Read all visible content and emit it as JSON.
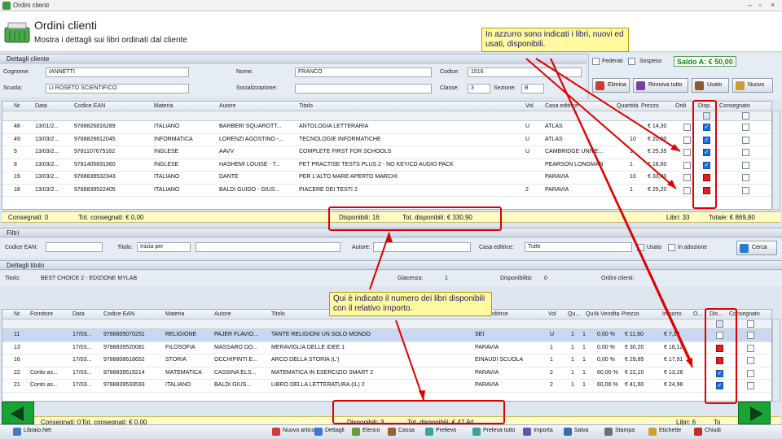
{
  "window": {
    "title": "Ordini clienti"
  },
  "header": {
    "title": "Ordini clienti",
    "subtitle": "Mostra i dettagli sui libri ordinati dal cliente"
  },
  "customer": {
    "section": "Dettagli cliente",
    "cognome_label": "Cognome:",
    "cognome": "IANNETTI",
    "nome_label": "Nome:",
    "nome": "FRANCO",
    "codice_label": "Codice:",
    "codice": "1516",
    "scuola_label": "Scuola:",
    "scuola": "LI ROSETO SCIENTIFICO",
    "socializzazione_label": "Socializzazione:",
    "classe_label": "Classe:",
    "classe": "3",
    "sezione_label": "Sezione:",
    "sezione": "B",
    "federati_label": "Federati",
    "sospeso_label": "Sospeso",
    "saldo": "Saldo A: € 50,00",
    "buttons": {
      "elimina": "Elimina",
      "rinnova": "Rinnova tutto",
      "usato": "Usato",
      "nuovo": "Nuovo"
    }
  },
  "orders": {
    "columns": [
      "Nr.",
      "Data",
      "Codice EAN",
      "Materia",
      "Autore",
      "Titolo",
      "Vol",
      "Casa editrice",
      "Quantità",
      "Prezzo",
      "Ordi",
      "Disp.",
      "Consegnato"
    ],
    "rows": [
      {
        "nr": "48",
        "data": "13/01/2...",
        "ean": "9788826816289",
        "materia": "ITALIANO",
        "autore": "BARBERI SQUAROTT...",
        "titolo": "ANTOLOGIA LETTERARIA",
        "vol": "U",
        "casa": "ATLAS",
        "qta": "",
        "prezzo": "€ 14,30",
        "disp": "blue"
      },
      {
        "nr": "49",
        "data": "13/03/2...",
        "ean": "9788826812045",
        "materia": "INFORMATICA",
        "autore": "LORENZI AGOSTINO -...",
        "titolo": "TECNOLOGIE INFORMATICHE",
        "vol": "U",
        "casa": "ATLAS",
        "qta": "10",
        "prezzo": "€ 20,00",
        "disp": "blue"
      },
      {
        "nr": "5",
        "data": "13/03/2...",
        "ean": "9781107675162",
        "materia": "INGLESE",
        "autore": "AAVV",
        "titolo": "COMPLETE FIRST FOR SCHOOLS",
        "vol": "U",
        "casa": "CAMBRIDGE UNIVE...",
        "qta": "1",
        "prezzo": "€ 25,35",
        "disp": "blue"
      },
      {
        "nr": "8",
        "data": "13/03/2...",
        "ean": "9781405831360",
        "materia": "INGLESE",
        "autore": "HASHEMI LOUISE - T...",
        "titolo": "PET PRACTISE TESTS PLUS 2 - NO KEY/CD AUDIO PACK",
        "vol": "",
        "casa": "PEARSON LONGMAN",
        "qta": "1",
        "prezzo": "€ 18,60",
        "disp": "blue"
      },
      {
        "nr": "19",
        "data": "13/03/2...",
        "ean": "9788839532343",
        "materia": "ITALIANO",
        "autore": "DANTE",
        "titolo": "PER L'ALTO MARE APERTO MARCHI",
        "vol": "",
        "casa": "PARAVIA",
        "qta": "10",
        "prezzo": "€ 33,40",
        "disp": "red"
      },
      {
        "nr": "18",
        "data": "13/03/2...",
        "ean": "9788839522405",
        "materia": "ITALIANO",
        "autore": "BALDI GUIDO - GIUS...",
        "titolo": "PIACERE DEI TESTI 2",
        "vol": "2",
        "casa": "PARAVIA",
        "qta": "1",
        "prezzo": "€ 25,20",
        "disp": "red"
      }
    ],
    "totals": {
      "consegnati": "Consegnati: 0",
      "tot_consegnati": "Tot. consegnati: € 0,00",
      "disponibili": "Disponibili: 16",
      "tot_disponibili": "Tot. disponibili: € 330,90",
      "libri": "Libri: 33",
      "totale": "Totale: € 869,80"
    }
  },
  "filters": {
    "section": "Filtri",
    "codice_ean": "Codice EAN:",
    "titolo": "Titolo:",
    "titolo_mode": "Inizia per",
    "autore": "Autore:",
    "casa_editrice": "Casa editrice:",
    "casa_value": "Tutte",
    "usato": "Usato",
    "in_adozione": "In adozione",
    "cerca": "Cerca"
  },
  "title_details": {
    "section": "Dettagli titolo",
    "titolo_label": "Titolo:",
    "titolo": "BEST CHOICE 2 - EDIZIONE MYLAB",
    "giacenza_label": "Giacenza:",
    "giacenza": "1",
    "disponibilita_label": "Disponibilità:",
    "disponibilita": "0",
    "ordini_label": "Ordini clienti:"
  },
  "title_orders": {
    "columns": [
      "Nr.",
      "Fornitore",
      "Data",
      "Codice EAN",
      "Materia",
      "Autore",
      "Titolo",
      "Casa editrice",
      "Vol",
      "Qu...",
      "Qu...",
      "% Vendita",
      "Prezzo",
      "Importo",
      "O...",
      "Dis...",
      "Consegnato"
    ],
    "rows": [
      {
        "nr": "11",
        "forn": "",
        "data": "17/03...",
        "ean": "9788805070251",
        "materia": "RELIGIONE",
        "autore": "PAJER FLAVIO...",
        "titolo": "TANTE RELIGIONI UN SOLO MONDO",
        "casa": "SEI",
        "vol": "U",
        "q1": "1",
        "q2": "1",
        "pct": "0,00 %",
        "prezzo": "€ 11,90",
        "imp": "€ 7,14",
        "disp": "white",
        "sel": true
      },
      {
        "nr": "13",
        "forn": "",
        "data": "17/03...",
        "ean": "9788839520081",
        "materia": "FILOSOFIA",
        "autore": "MASSARO DO...",
        "titolo": "MERAVIGLIA DELLE IDEE 1",
        "casa": "PARAVIA",
        "vol": "1",
        "q1": "1",
        "q2": "1",
        "pct": "0,00 %",
        "prezzo": "€ 30,20",
        "imp": "€ 18,12",
        "disp": "red",
        "sel": false
      },
      {
        "nr": "16",
        "forn": "",
        "data": "17/03...",
        "ean": "9788808618652",
        "materia": "STORIA",
        "autore": "OCCHIPINTI E...",
        "titolo": "ARCO DELLA STORIA (L')",
        "casa": "EINAUDI SCUOLA",
        "vol": "1",
        "q1": "1",
        "q2": "1",
        "pct": "0,00 %",
        "prezzo": "€ 29,85",
        "imp": "€ 17,91",
        "disp": "red",
        "sel": false
      },
      {
        "nr": "22",
        "forn": "Conto as...",
        "data": "17/03...",
        "ean": "9788839519214",
        "materia": "MATEMATICA",
        "autore": "CASSINA ELS...",
        "titolo": "MATEMATICA IN ESERCIZIO SMART 2",
        "casa": "PARAVIA",
        "vol": "2",
        "q1": "1",
        "q2": "1",
        "pct": "60,00 %",
        "prezzo": "€ 22,10",
        "imp": "€ 13,26",
        "disp": "blue",
        "sel": false
      },
      {
        "nr": "21",
        "forn": "Conto as...",
        "data": "17/03...",
        "ean": "9788839533593",
        "materia": "ITALIANO",
        "autore": "BALDI GIUS...",
        "titolo": "LIBRO DELLA LETTERATURA (IL) 2",
        "casa": "PARAVIA",
        "vol": "2",
        "q1": "1",
        "q2": "1",
        "pct": "60,00 %",
        "prezzo": "€ 41,60",
        "imp": "€ 24,96",
        "disp": "blue",
        "sel": false
      }
    ],
    "totals": {
      "consegnati": "Consegnati: 0",
      "tot_consegnati": "Tot. consegnati: € 0,00",
      "disponibili": "Disponibili: 3",
      "tot_disponibili": "Tot. disponibili: € 47,94",
      "libri": "Libri: 6",
      "totale": "To"
    }
  },
  "annotations": {
    "top": "In azzurro sono indicati i libri, nuovi ed usati, disponibili.",
    "middle": "Qui è indicato il numero dei libri disponibili con il relativo importo."
  },
  "bottombar": {
    "app": "Libraio.Net",
    "nuovo": "Nuovo articolo",
    "dettagli": "Dettagli",
    "elenco": "Elenco",
    "cassa": "Cassa",
    "prelievo": "Prelievo",
    "prelievo_tutto": "Preleva tutto",
    "importa": "Importa",
    "salva": "Salva",
    "stampa": "Stampa",
    "etichette": "Etichette",
    "chiudi": "Chiudi"
  },
  "colors": {
    "available": "#1e6fd9",
    "unavailable": "#e02020",
    "totals_bg": "#fffbc4",
    "annotation": "#e00000"
  }
}
